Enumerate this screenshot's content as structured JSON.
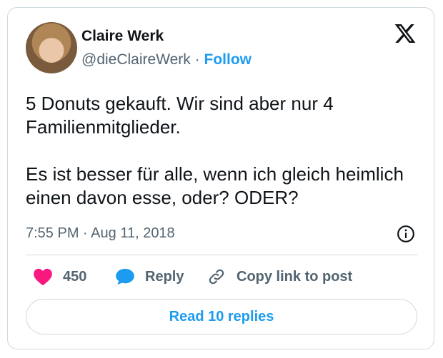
{
  "author": {
    "name": "Claire Werk",
    "handle": "@dieClaireWerk",
    "separator": "·",
    "follow_label": "Follow"
  },
  "tweet": {
    "paragraphs": [
      "5 Donuts gekauft. Wir sind aber nur 4 Familienmitglieder.",
      "Es ist besser für alle, wenn ich gleich heimlich einen davon esse, oder? ODER?"
    ],
    "time": "7:55 PM",
    "date_separator": "·",
    "date": "Aug 11, 2018"
  },
  "actions": {
    "like_count": "450",
    "reply_label": "Reply",
    "copy_label": "Copy link to post"
  },
  "footer": {
    "read_replies_label": "Read 10 replies"
  },
  "colors": {
    "accent": "#1d9bf0",
    "like": "#f91880",
    "text": "#0f1419",
    "muted": "#536471",
    "border": "#cfd9de"
  },
  "icons": [
    "x-logo-icon",
    "info-icon",
    "heart-icon",
    "reply-bubble-icon",
    "link-icon"
  ]
}
